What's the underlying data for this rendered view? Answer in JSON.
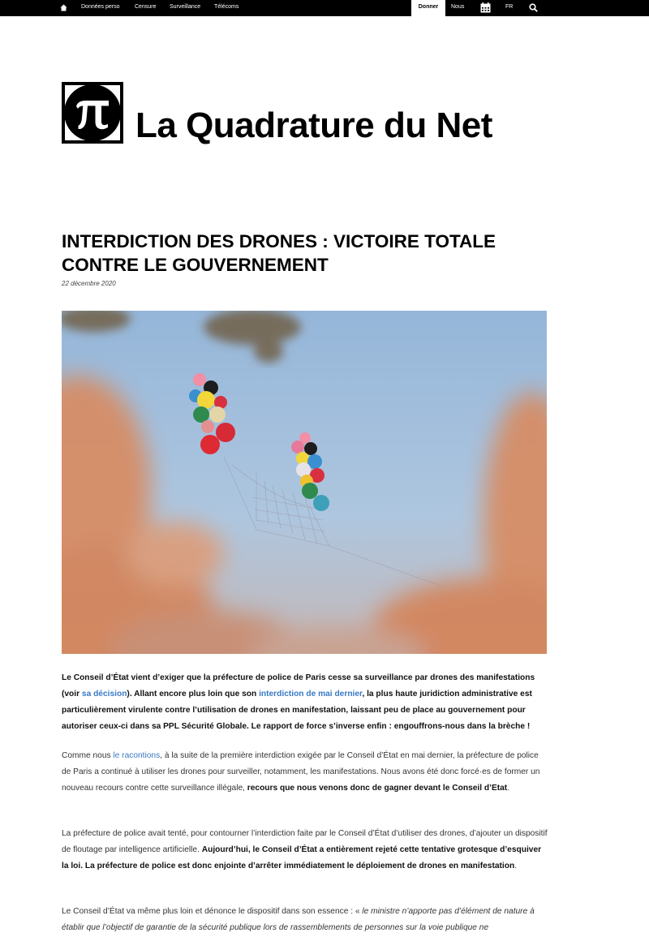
{
  "nav": {
    "home_icon": "home-icon",
    "links": [
      "Données perso",
      "Censure",
      "Surveillance",
      "Télécoms"
    ],
    "donate": "Donner",
    "about": "Nous",
    "calendar_icon": "calendar-icon",
    "lang": "FR",
    "search_icon": "search-icon",
    "bg_color": "#000000"
  },
  "logo": {
    "symbol": "π",
    "name": "La Quadrature du Net"
  },
  "article": {
    "title": "Interdiction des drones : victoire totale contre le gouvernement",
    "date": "22 décembre 2020",
    "p1": {
      "t1": "Le Conseil d’État vient d’exiger que la préfecture de police de Paris cesse sa surveillance par drones des manifestations (voir ",
      "link1": "sa décision",
      "t2": "). Allant encore plus loin que son ",
      "link2": "interdiction de mai dernier",
      "t3": ", la plus haute juridiction administrative est particulièrement virulente contre l’utilisation de drones en manifestation, laissant peu de place au gouvernement pour autoriser ceux-ci dans sa PPL Sécurité Globale. Le rapport de force s’inverse enfin : engouffrons-nous dans la brèche !"
    },
    "p2": {
      "t1": "Comme nous ",
      "link1": "le racontions",
      "t2": ", à la suite de la première interdiction exigée par le Conseil d’État en mai dernier, la préfecture de police de Paris a continué à utiliser les drones pour surveiller, notamment, les manifestations. Nous avons été donc forcé·es de former un nouveau recours contre cette surveillance illégale, ",
      "bold": "recours que nous venons donc de gagner devant le Conseil d’Etat",
      "t3": "."
    },
    "p3": {
      "t1": "La préfecture de police avait tenté, pour contourner l’interdiction faite par le Conseil d’État d’utiliser des drones, d’ajouter un dispositif de floutage par intelligence artificielle. ",
      "bold": "Aujourd’hui, le Conseil d’État a entièrement rejeté cette tentative grotesque d’esquiver la loi. La préfecture de police est donc enjointe d’arrêter immédiatement le déploiement de drones en manifestation",
      "t2": "."
    },
    "p4": {
      "t1": "Le Conseil d’État va même plus loin et dénonce le dispositif dans son essence : « ",
      "italic": "le ministre n’apporte pas d’élément de nature à établir que l’objectif de garantie de la sécurité publique lors de rassemblements de personnes sur la voie publique ne"
    }
  },
  "colors": {
    "link": "#3a79c4",
    "sky": "#a9c3de",
    "foliage": "#d98a5e"
  }
}
